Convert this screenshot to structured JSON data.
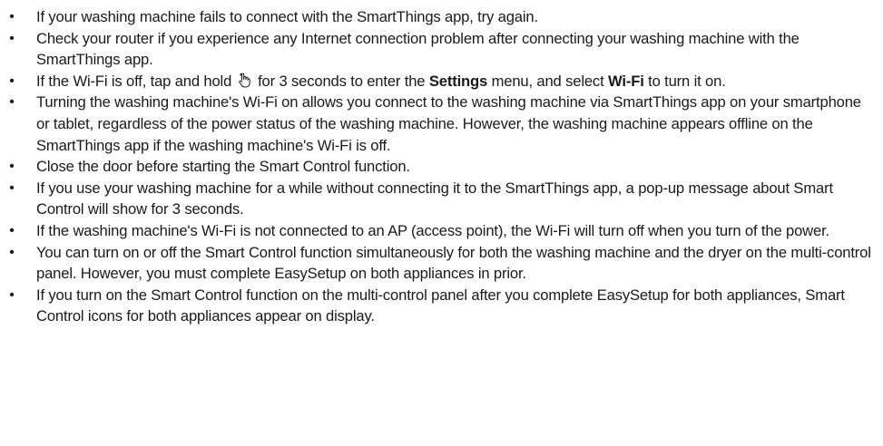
{
  "bullet_glyph": "•",
  "notes": {
    "item1": {
      "text": "If your washing machine fails to connect with the SmartThings app, try again."
    },
    "item2": {
      "text": "Check your router if you experience any Internet connection problem after connecting your washing machine with the SmartThings app."
    },
    "item3": {
      "part1": "If the Wi-Fi is off, tap and hold ",
      "icon": "hand-tap-plus-icon",
      "part2": " for 3 seconds to enter the ",
      "bold1": "Settings",
      "part3": " menu, and select ",
      "bold2": "Wi-Fi",
      "part4": " to turn it on."
    },
    "item4": {
      "text": "Turning the washing machine's Wi-Fi on allows you connect to the washing machine via SmartThings app on your smartphone or tablet, regardless of the power status of the washing machine. However, the washing machine appears offline on the SmartThings app if the washing machine's Wi-Fi is off."
    },
    "item5": {
      "text": "Close the door before starting the Smart Control function."
    },
    "item6": {
      "text": "If you use your washing machine for a while without connecting it to the SmartThings app, a pop-up message about Smart Control will show for 3 seconds."
    },
    "item7": {
      "text": "If the washing machine's Wi-Fi is not connected to an AP (access point), the Wi-Fi will turn off when you turn of the power."
    },
    "item8": {
      "text": "You can turn on or off the Smart Control function simultaneously for both the washing machine and the dryer on the multi-control panel. However, you must complete EasySetup on both appliances in prior."
    },
    "item9": {
      "text": "If you turn on the Smart Control function on the multi-control panel after you complete EasySetup for both appliances, Smart Control icons for both appliances appear on display."
    }
  }
}
